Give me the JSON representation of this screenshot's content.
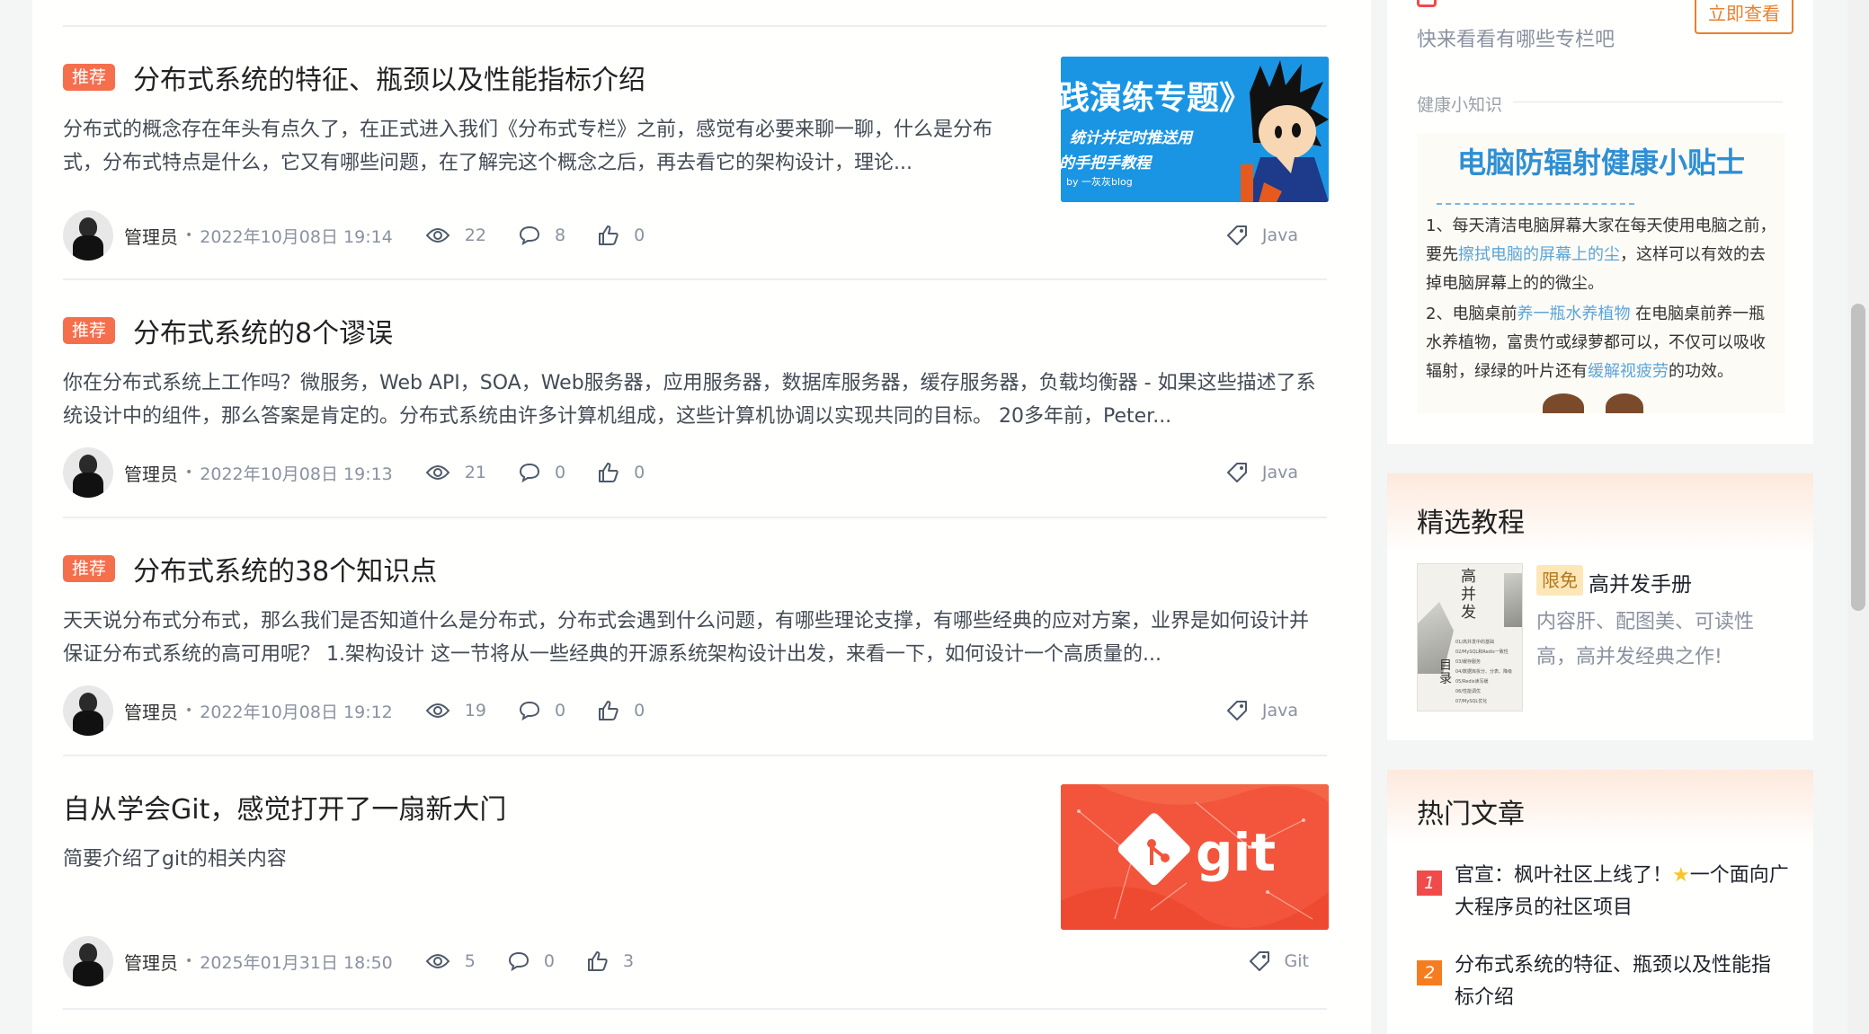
{
  "articles": [
    {
      "badge": "推荐",
      "title": "分布式系统的特征、瓶颈以及性能指标介绍",
      "desc": "分布式的概念存在年头有点久了，在正式进入我们《分布式专栏》之前，感觉有必要来聊一聊，什么是分布式，分布式特点是什么，它又有哪些问题，在了解完这个概念之后，再去看它的架构设计，理论...",
      "author": "管理员",
      "date": "2022年10月08日 19:14",
      "views": "22",
      "comments": "8",
      "likes": "0",
      "tag": "Java",
      "thumb": {
        "line1": "践演练专题》",
        "line2": "统计并定时推送用",
        "line3": "的手把手教程",
        "line4": "by 一灰灰blog"
      }
    },
    {
      "badge": "推荐",
      "title": "分布式系统的8个谬误",
      "desc": "你在分布式系统上工作吗？微服务，Web API，SOA，Web服务器，应用服务器，数据库服务器，缓存服务器，负载均衡器 - 如果这些描述了系统设计中的组件，那么答案是肯定的。分布式系统由许多计算机组成，这些计算机协调以实现共同的目标。 20多年前，Peter...",
      "author": "管理员",
      "date": "2022年10月08日 19:13",
      "views": "21",
      "comments": "0",
      "likes": "0",
      "tag": "Java"
    },
    {
      "badge": "推荐",
      "title": "分布式系统的38个知识点",
      "desc": "天天说分布式分布式，那么我们是否知道什么是分布式，分布式会遇到什么问题，有哪些理论支撑，有哪些经典的应对方案，业界是如何设计并保证分布式系统的高可用呢？ 1.架构设计 这一节将从一些经典的开源系统架构设计出发，来看一下，如何设计一个高质量的...",
      "author": "管理员",
      "date": "2022年10月08日 19:12",
      "views": "19",
      "comments": "0",
      "likes": "0",
      "tag": "Java"
    },
    {
      "title": "自从学会Git，感觉打开了一扇新大门",
      "desc": "简要介绍了git的相关内容",
      "author": "管理员",
      "date": "2025年01月31日 18:50",
      "views": "5",
      "comments": "0",
      "likes": "3",
      "tag": "Git",
      "thumb": {
        "logo": "git"
      }
    }
  ],
  "sidebar": {
    "promo": {
      "subtitle": "快来看看有哪些专栏吧",
      "button": "立即查看"
    },
    "health": {
      "label": "健康小知识",
      "heading": "电脑防辐射健康小贴士",
      "tip1_a": "1、每天清洁电脑屏幕大家在每天使用电脑之前，要先",
      "tip1_hl": "擦拭电脑的屏幕上的尘",
      "tip1_b": "，这样可以有效的去掉电脑屏幕上的的微尘。",
      "tip2_a": "2、电脑桌前",
      "tip2_hl": "养一瓶水养植物",
      "tip2_b": " 在电脑桌前养一瓶水养植物，富贵竹或绿萝都可以，不仅可以吸收辐射，绿绿的叶片还有",
      "tip2_hl2": "缓解视疲劳",
      "tip2_c": "的功效。"
    },
    "tutorials": {
      "title": "精选教程",
      "badge": "限免",
      "name": "高并发手册",
      "desc": "内容肝、配图美、可读性高，高并发经典之作!",
      "cover_title": "高并发",
      "cover_toc": "目录",
      "cover_items": [
        "01/高并发中的基础",
        "02/MySQL和Redis一致性",
        "03/缓存服务",
        "04/数据库拆分、分表、降级",
        "05/Redis读写缓",
        "06/性能调优",
        "07/MySQL优化"
      ]
    },
    "hot": {
      "title": "热门文章",
      "items": [
        {
          "rank": "1",
          "text_a": "官宣：枫叶社区上线了！",
          "text_b": "一个面向广大程序员的社区项目"
        },
        {
          "rank": "2",
          "text_a": "分布式系统的特征、瓶颈以及性能指标介绍",
          "text_b": ""
        }
      ]
    }
  },
  "colors": {
    "badge": "#f56f4d",
    "link_orange": "#e8802d",
    "rank1": "#f04a4a",
    "rank2": "#f57d1f",
    "meta": "#8a919f"
  }
}
